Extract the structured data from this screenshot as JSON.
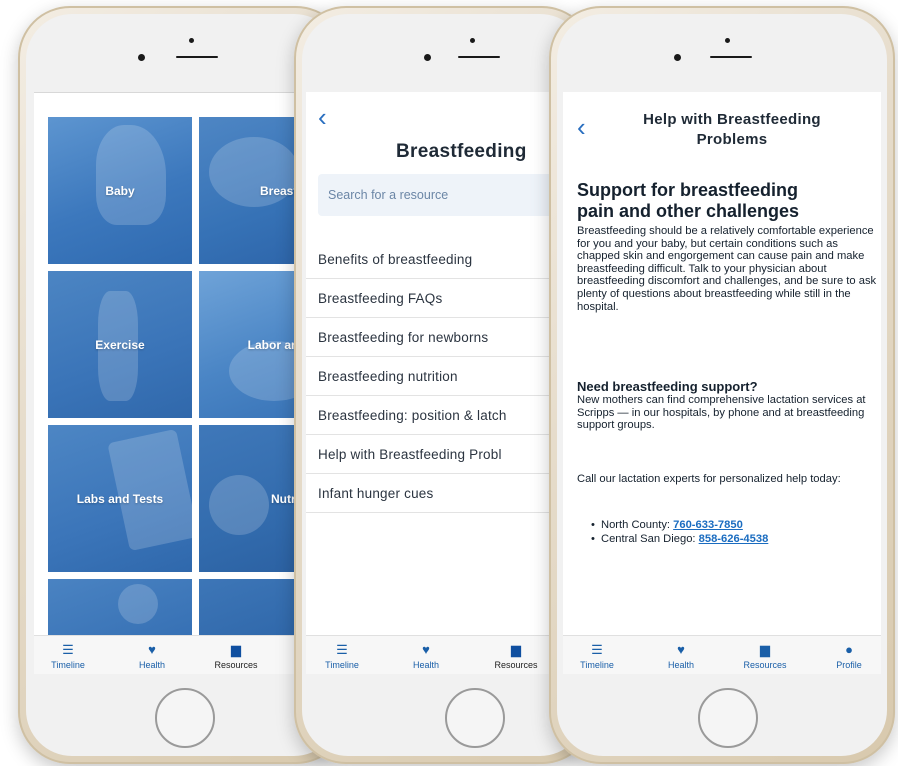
{
  "phone1": {
    "tiles": [
      {
        "label": "Baby"
      },
      {
        "label": "Breastfeed"
      },
      {
        "label": "Exercise"
      },
      {
        "label": "Labor and De"
      },
      {
        "label": "Labs and Tests"
      },
      {
        "label": "Nutrition"
      },
      {
        "label": ""
      },
      {
        "label": ""
      }
    ],
    "tabs": [
      "Timeline",
      "Health",
      "Resources"
    ]
  },
  "phone2": {
    "back_icon": "chevron-left-icon",
    "title": "Breastfeeding",
    "search_placeholder": "Search for a resource",
    "items": [
      "Benefits of breastfeeding",
      "Breastfeeding FAQs",
      "Breastfeeding for newborns",
      "Breastfeeding nutrition",
      "Breastfeeding: position & latch",
      "Help with Breastfeeding Probl",
      "Infant hunger cues"
    ],
    "tabs": [
      "Timeline",
      "Health",
      "Resources"
    ]
  },
  "phone3": {
    "back_icon": "chevron-left-icon",
    "header_line1": "Help with Breastfeeding",
    "header_line2": "Problems",
    "h1_line1": "Support for breastfeeding",
    "h1_line2": "pain and other challenges",
    "para1": "Breastfeeding should be a relatively comfortable experience for you and your baby, but certain conditions such as chapped skin and engorgement can cause pain and make breastfeeding difficult. Talk to your physician about breastfeeding discomfort and challenges, and be sure to ask plenty of questions about breastfeeding while still in the hospital.",
    "h2": "Need breastfeeding support?",
    "para2": "New mothers can find comprehensive lactation services at Scripps — in our hospitals, by phone and at breastfeeding support groups.",
    "para3": "Call our lactation experts for personalized help today:",
    "contacts": [
      {
        "label": "North County: ",
        "phone": "760-633-7850"
      },
      {
        "label": "Central San Diego: ",
        "phone": "858-626-4538"
      }
    ],
    "tabs": [
      "Timeline",
      "Health",
      "Resources",
      "Profile"
    ]
  },
  "colors": {
    "accent": "#1a5fa8",
    "tile_blue": "#2f6fb5",
    "link": "#1a6cc0"
  }
}
